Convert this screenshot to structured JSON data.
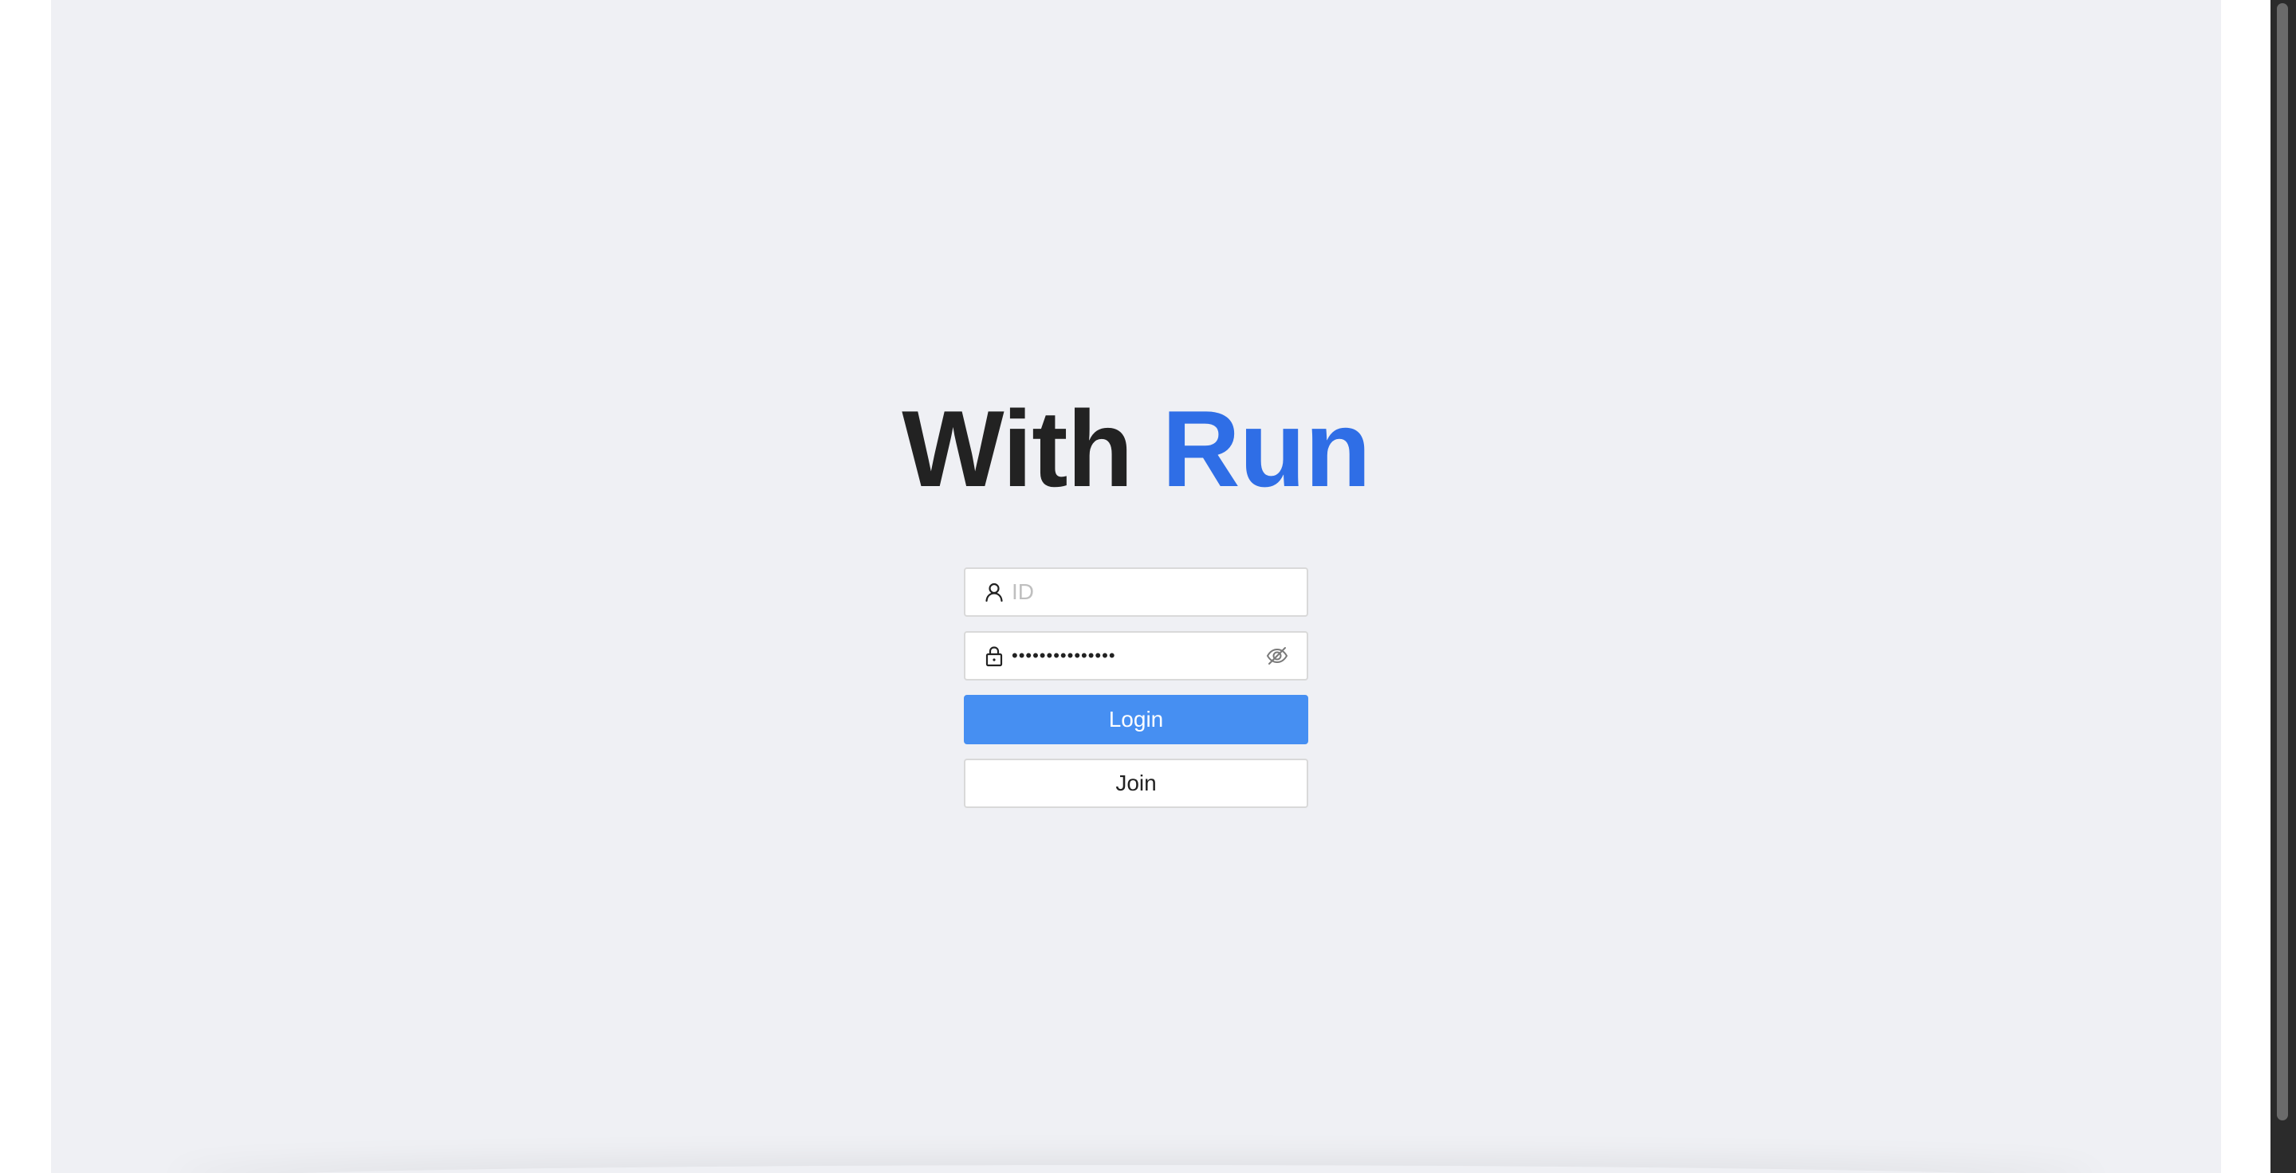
{
  "header": {
    "title_part1": "With",
    "title_part2": "Run"
  },
  "login_form": {
    "id_field": {
      "placeholder": "ID",
      "value": "",
      "icon": "user-icon"
    },
    "password_field": {
      "value": "•••••••••••••••",
      "icon": "lock-icon",
      "toggle_icon": "eye-off-icon"
    },
    "login_label": "Login",
    "join_label": "Join"
  },
  "colors": {
    "background": "#eff0f4",
    "accent": "#2f6ee6",
    "primary_button": "#468ff2",
    "title_text": "#222222"
  }
}
